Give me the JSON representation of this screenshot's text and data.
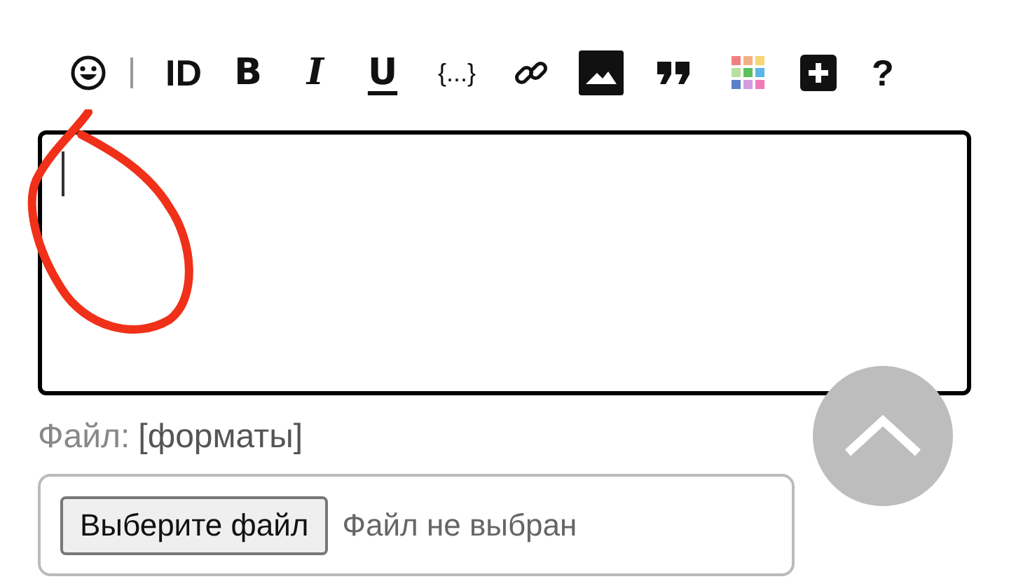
{
  "toolbar": [
    {
      "kind": "smiley"
    },
    {
      "kind": "separator"
    },
    {
      "kind": "text",
      "label": "ID"
    },
    {
      "kind": "bold",
      "label": "B"
    },
    {
      "kind": "italic",
      "label": "I"
    },
    {
      "kind": "underline",
      "label": "U"
    },
    {
      "kind": "code",
      "label": "{...}"
    },
    {
      "kind": "link"
    },
    {
      "kind": "image"
    },
    {
      "kind": "quote"
    },
    {
      "kind": "colors"
    },
    {
      "kind": "plus"
    },
    {
      "kind": "text",
      "label": "?"
    }
  ],
  "editor": {
    "focused": true
  },
  "file": {
    "label": "Файл:",
    "formats": "[форматы]",
    "button": "Выберите файл",
    "status": "Файл не выбран"
  }
}
